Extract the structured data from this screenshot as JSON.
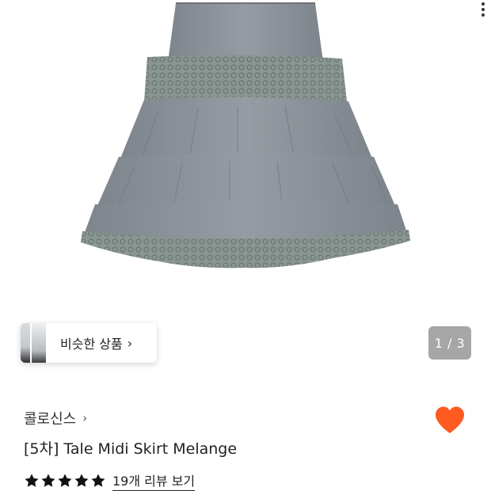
{
  "gallery": {
    "image_alt": "Tale Midi Skirt Melange product photo",
    "counter": "1 / 3",
    "similar_label": "비슷한 상품",
    "similar_chevron": "›"
  },
  "product": {
    "brand": "콜로신스",
    "brand_chevron": "›",
    "title": "[5차] Tale Midi Skirt Melange",
    "rating": 5,
    "review_link": "19개 리뷰 보기",
    "liked": true
  },
  "colors": {
    "heart": "#ff5a1f",
    "skirt": "#8f959c",
    "lace": "#7d8985"
  }
}
